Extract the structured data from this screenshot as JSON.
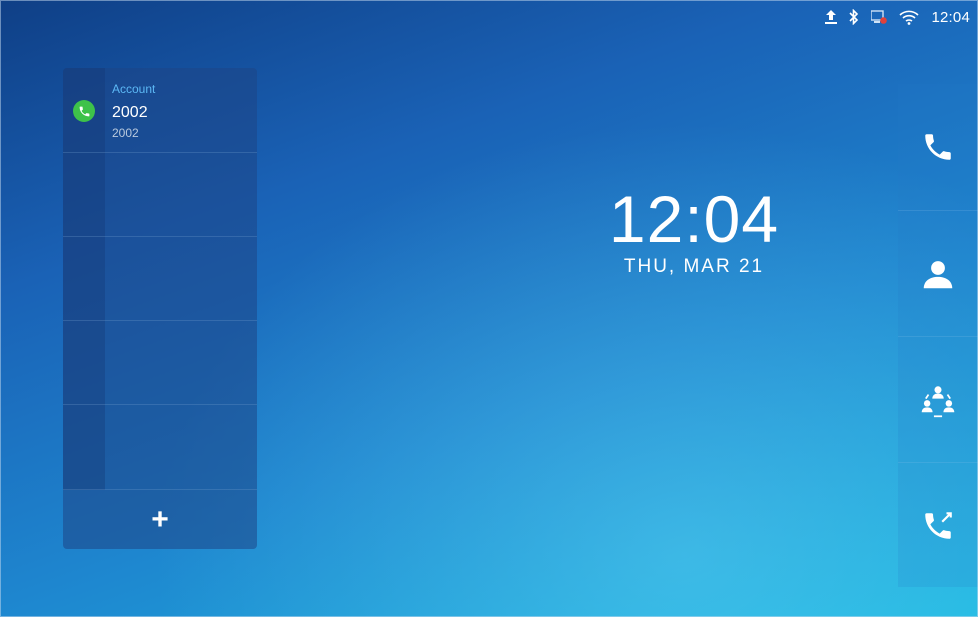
{
  "status_bar": {
    "time": "12:04",
    "icons": [
      "upload-icon",
      "bluetooth-icon",
      "network-disconnected-icon",
      "wifi-icon"
    ]
  },
  "account_panel": {
    "account": {
      "label": "Account",
      "name": "2002",
      "number": "2002",
      "status_color": "#3ec24a",
      "icon": "phone-icon"
    },
    "empty_slots": 4,
    "add_button": {
      "label": "+"
    }
  },
  "clock": {
    "time": "12:04",
    "date": "THU, MAR 21"
  },
  "dock": {
    "items": [
      {
        "icon": "phone-icon",
        "name": "dialer"
      },
      {
        "icon": "contact-icon",
        "name": "contacts"
      },
      {
        "icon": "conference-icon",
        "name": "conference"
      },
      {
        "icon": "call-history-icon",
        "name": "call-history"
      }
    ]
  }
}
